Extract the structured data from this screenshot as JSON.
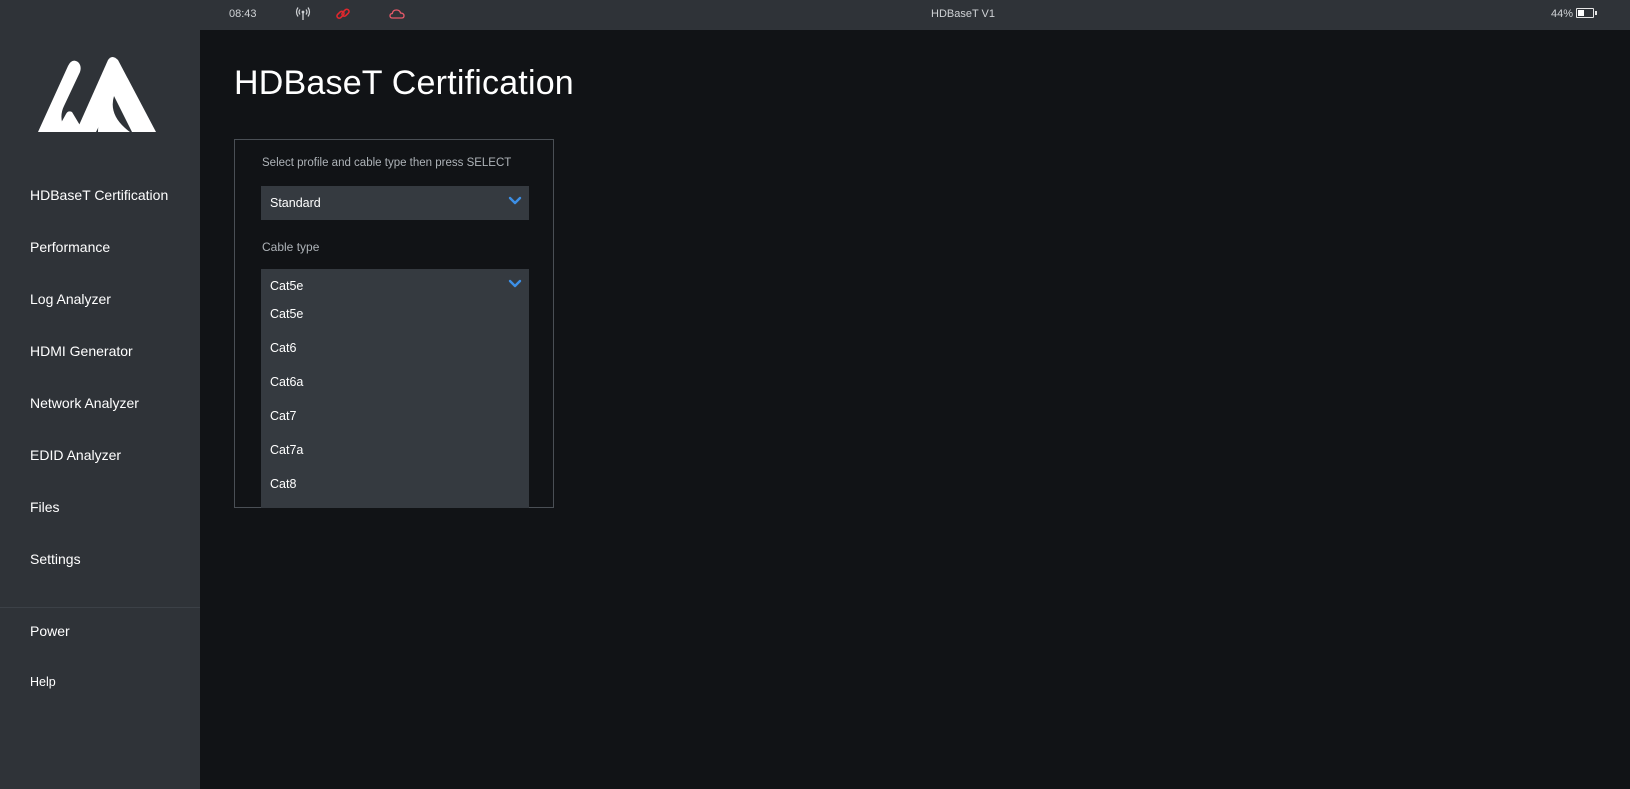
{
  "status_bar": {
    "time": "08:43",
    "device_title": "HDBaseT V1",
    "battery_percent_label": "44%",
    "battery_level": 0.44,
    "icons": [
      "antenna-icon",
      "link-icon",
      "cloud-icon"
    ],
    "link_icon_color": "#e0282e",
    "cloud_icon_color": "#e85a6a"
  },
  "sidebar": {
    "logo": "brand-logo",
    "items": [
      {
        "label": "HDBaseT Certification"
      },
      {
        "label": "Performance"
      },
      {
        "label": "Log Analyzer"
      },
      {
        "label": "HDMI Generator"
      },
      {
        "label": "Network Analyzer"
      },
      {
        "label": "EDID Analyzer"
      },
      {
        "label": "Files"
      },
      {
        "label": "Settings"
      }
    ],
    "bottom_items": [
      {
        "label": "Power"
      },
      {
        "label": "Help"
      }
    ]
  },
  "main": {
    "title": "HDBaseT Certification",
    "hint": "Select profile and cable type then press SELECT",
    "profile_select": {
      "value": "Standard"
    },
    "cable_type_label": "Cable type",
    "cable_select": {
      "value": "Cat5e",
      "options": [
        "Cat5e",
        "Cat6",
        "Cat6a",
        "Cat7",
        "Cat7a",
        "Cat8"
      ]
    }
  },
  "colors": {
    "accent": "#3d8fe6",
    "sidebar_bg": "#2f3338",
    "main_bg": "#111316",
    "field_bg": "#353a40"
  }
}
